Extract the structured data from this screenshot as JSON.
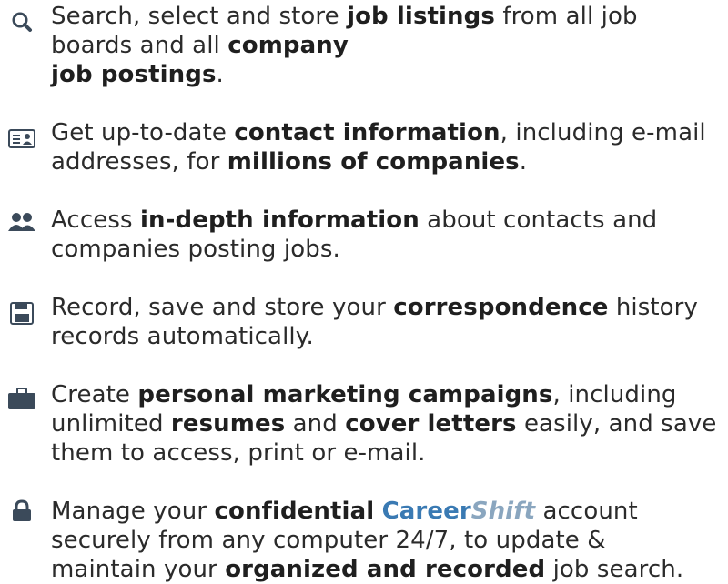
{
  "features": [
    {
      "icon": "search-icon",
      "lines": [
        {
          "a": "Search, select and store ",
          "b": "job listings",
          "c": " from all job"
        },
        {
          "a": "boards and all ",
          "b": "company",
          "c": ""
        },
        {
          "a": "",
          "b": "job postings",
          "c": "."
        }
      ]
    },
    {
      "icon": "contact-card-icon",
      "lines": [
        {
          "a": "Get up-to-date ",
          "b": "contact information",
          "c": ", including e-mail"
        },
        {
          "a": "addresses, for ",
          "b": "millions of companies",
          "c": "."
        }
      ]
    },
    {
      "icon": "people-icon",
      "lines": [
        {
          "a": "Access ",
          "b": "in-depth information",
          "c": " about contacts and"
        },
        {
          "a": "companies posting jobs.",
          "b": "",
          "c": ""
        }
      ]
    },
    {
      "icon": "floppy-disk-icon",
      "lines": [
        {
          "a": "Record, save and store your ",
          "b": "correspondence",
          "c": " history"
        },
        {
          "a": "records automatically.",
          "b": "",
          "c": ""
        }
      ]
    },
    {
      "icon": "briefcase-icon",
      "lines": [
        {
          "a": "Create ",
          "b": "personal marketing campaigns",
          "c": ", including"
        },
        {
          "a": "unlimited ",
          "b": "resumes",
          "c": " and ",
          "d": "cover letters",
          "e": " easily, and save"
        },
        {
          "a": "them to access, print or e-mail.",
          "b": "",
          "c": ""
        }
      ]
    },
    {
      "icon": "lock-icon",
      "lines": [
        {
          "a": "Manage your ",
          "b": "confidential",
          "c": " ",
          "brand1": "Career",
          "brand2": "Shift",
          "d2": " account"
        },
        {
          "a": "securely from any computer 24/7, to update &",
          "b": "",
          "c": ""
        },
        {
          "a": "maintain your ",
          "b": "organized and recorded",
          "c": " job search."
        }
      ]
    }
  ]
}
